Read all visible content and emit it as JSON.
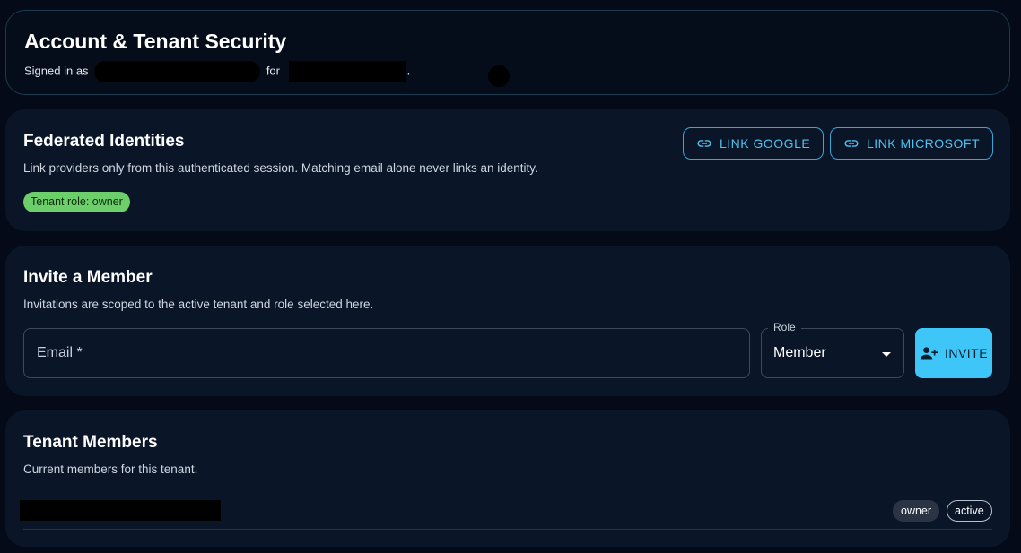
{
  "header": {
    "title": "Account & Tenant Security",
    "signed_in_prefix": "Signed in as",
    "for_word": "for",
    "trailing": "."
  },
  "federated": {
    "title": "Federated Identities",
    "description": "Link providers only from this authenticated session. Matching email alone never links an identity.",
    "link_google_label": "LINK GOOGLE",
    "link_microsoft_label": "LINK MICROSOFT",
    "role_chip": "Tenant role: owner",
    "icon": "link-icon"
  },
  "invite": {
    "title": "Invite a Member",
    "description": "Invitations are scoped to the active tenant and role selected here.",
    "email_label": "Email *",
    "role_label": "Role",
    "role_value": "Member",
    "invite_label": "INVITE",
    "invite_icon": "person-add-icon"
  },
  "members": {
    "title": "Tenant Members",
    "description": "Current members for this tenant.",
    "rows": [
      {
        "role": "owner",
        "status": "active"
      }
    ]
  },
  "colors": {
    "background": "#040a17",
    "card": "#0a1528",
    "accent": "#3ec6f8",
    "link_text": "#4fc3f0",
    "role_chip": "#6ccf6a"
  }
}
